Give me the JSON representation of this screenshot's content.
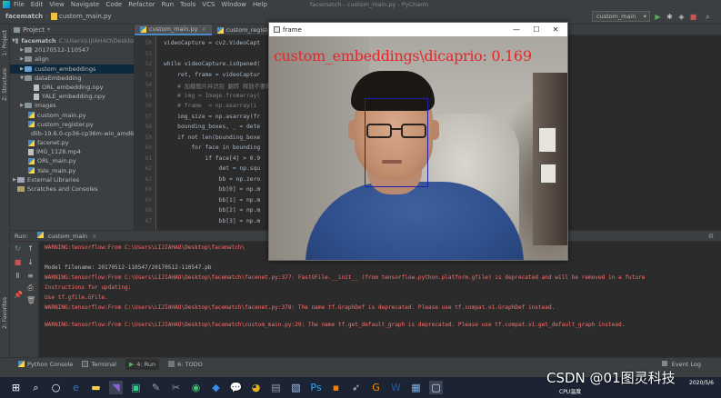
{
  "menu": {
    "items": [
      "File",
      "Edit",
      "View",
      "Navigate",
      "Code",
      "Refactor",
      "Run",
      "Tools",
      "VCS",
      "Window",
      "Help"
    ],
    "window_title": "facematch - custom_main.py - PyCharm"
  },
  "navbar": {
    "project": "facematch",
    "file": "custom_main.py",
    "run_config": "custom_main"
  },
  "project_panel": {
    "title": "Project",
    "root": "facematch",
    "root_path": "C:\\Users\\LIJIAHAO\\Deskto",
    "items": [
      {
        "label": "20170512-110547",
        "kind": "folder"
      },
      {
        "label": "align",
        "kind": "folder"
      },
      {
        "label": "custom_embeddings",
        "kind": "folder"
      },
      {
        "label": "dataEmbedding",
        "kind": "folder"
      },
      {
        "label": "ORL_embedding.npy",
        "kind": "file"
      },
      {
        "label": "YALE_embedding.npy",
        "kind": "file"
      },
      {
        "label": "images",
        "kind": "folder"
      },
      {
        "label": "custom_main.py",
        "kind": "py"
      },
      {
        "label": "custom_register.py",
        "kind": "py"
      },
      {
        "label": "dlib-19.6.0-cp36-cp36m-win_amd6",
        "kind": "file"
      },
      {
        "label": "facenet.py",
        "kind": "py"
      },
      {
        "label": "IMG_1128.mp4",
        "kind": "file"
      },
      {
        "label": "ORL_main.py",
        "kind": "py"
      },
      {
        "label": "Yale_main.py",
        "kind": "py"
      },
      {
        "label": "External Libraries",
        "kind": "lib"
      },
      {
        "label": "Scratches and Consoles",
        "kind": "lib"
      }
    ]
  },
  "left_strip": {
    "project": "1: Project",
    "structure": "Z: Structure",
    "favorites": "2: Favorites"
  },
  "editor": {
    "tabs": [
      "custom_main.py",
      "custom_register.py"
    ],
    "line_numbers": [
      "50",
      "51",
      "52",
      "53",
      "54",
      "55",
      "56",
      "57",
      "58",
      "59",
      "60",
      "61",
      "62",
      "63",
      "64",
      "65",
      "66",
      "67"
    ],
    "lines": [
      "videoCapture = cv2.VideoCapt",
      "",
      "while videoCapture.isOpened(",
      "    ret, frame = videoCaptur",
      "    # 加载图片并识别 翻转 释放不要的",
      "    # img = Image.fromarray(",
      "    # frame  = np.asarray(i",
      "    img_size = np.asarray(fr",
      "    bounding_boxes, _ = dete",
      "    if not len(bounding_boxe",
      "        for face in bounding",
      "            if face[4] > 0.9",
      "                det = np.squ",
      "                bb = np.zero",
      "                bb[0] = np.m",
      "                bb[1] = np.m",
      "                bb[2] = np.m",
      "                bb[3] = np.m"
    ]
  },
  "run_panel": {
    "label": "Run:",
    "tab": "custom_main",
    "console": [
      {
        "type": "err",
        "text": "WARNING:tensorflow:From C:\\Users\\LIJIAHAO\\Desktop\\facematch\\                                                          ompat.v1.nn.xw_plus_b instead."
      },
      {
        "type": "out",
        "text": ""
      },
      {
        "type": "out",
        "text": "Model filename: 20170512-110547/20170512-110547.pb"
      },
      {
        "type": "err",
        "text": "WARNING:tensorflow:From C:\\Users\\LIJIAHAO\\Desktop\\facematch\\facenet.py:377: FastGFile.__init__ (from tensorflow.python.platform.gfile) is deprecated and will be removed in a future"
      },
      {
        "type": "err",
        "text": "Instructions for updating:"
      },
      {
        "type": "err",
        "text": "Use tf.gfile.GFile."
      },
      {
        "type": "err",
        "text": "WARNING:tensorflow:From C:\\Users\\LIJIAHAO\\Desktop\\facematch\\facenet.py:378: The name tf.GraphDef is deprecated. Please use tf.compat.v1.GraphDef instead."
      },
      {
        "type": "out",
        "text": ""
      },
      {
        "type": "err",
        "text": "WARNING:tensorflow:From C:\\Users\\LIJIAHAO\\Desktop\\facematch\\custom_main.py:29: The name tf.get_default_graph is deprecated. Please use tf.compat.v1.get_default_graph instead."
      }
    ]
  },
  "bottom_tabs": [
    "Python Console",
    "Terminal",
    "4: Run",
    "6: TODO"
  ],
  "event_log": "Event Log",
  "frame_window": {
    "title": "frame",
    "detection_label": "custom_embeddings\\dicaprio: 0.169"
  },
  "taskbar": {
    "cpu": "CPU温度",
    "date": "2020/5/6"
  },
  "watermark": "CSDN @01图灵科技",
  "colors": {
    "error_text": "#ff6b68",
    "label_red": "#e6262b",
    "box_blue": "#2020b0",
    "accent": "#4a88c7"
  }
}
